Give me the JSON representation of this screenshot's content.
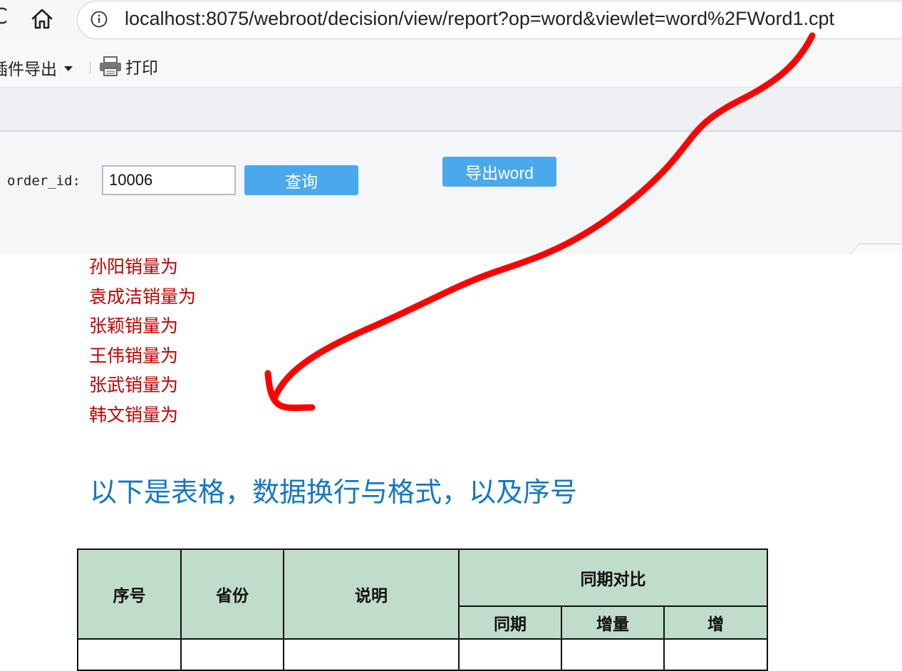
{
  "browser": {
    "back_glyph": "C",
    "home_icon": "home-icon",
    "info_icon": "info-icon",
    "url": "localhost:8075/webroot/decision/view/report?op=word&viewlet=word%2FWord1.cpt"
  },
  "toolbar": {
    "plugin_export_label": "插件导出",
    "print_label": "打印",
    "print_icon": "printer-icon"
  },
  "params": {
    "order_id_label": "order_id:",
    "order_id_value": "10006",
    "query_label": "查询",
    "export_word_label": "导出word",
    "button_color": "#4aa9ea"
  },
  "report": {
    "sales_lines": [
      "孙阳销量为",
      "袁成洁销量为",
      "张颖销量为",
      "王伟销量为",
      "张武销量为",
      "韩文销量为"
    ],
    "sales_color": "#c00000",
    "heading": "以下是表格，数据换行与格式，以及序号",
    "heading_color": "#1577c2",
    "table": {
      "header_bg": "#c0dccb",
      "col_seq": "序号",
      "col_province": "省份",
      "col_desc": "说明",
      "group_compare": "同期对比",
      "sub_same_period": "同期",
      "sub_increment": "增量",
      "sub_growth": "增"
    }
  },
  "annotation": {
    "color": "#ff0000",
    "shape": "hand-drawn arrow"
  }
}
